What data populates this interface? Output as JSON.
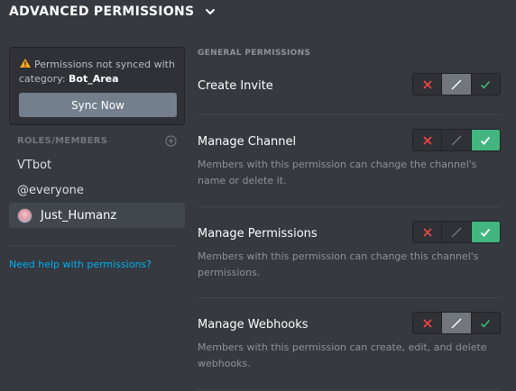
{
  "header": {
    "title": "ADVANCED PERMISSIONS",
    "icon": "chevron-down-icon"
  },
  "sync": {
    "message": "Permissions not synced with category:",
    "category": "Bot_Area",
    "button_label": "Sync Now",
    "icon": "warning-icon"
  },
  "roles": {
    "heading": "ROLES/MEMBERS",
    "add_icon": "add-circle-icon",
    "items": [
      {
        "label": "VTbot",
        "selected": false,
        "avatar": false
      },
      {
        "label": "@everyone",
        "selected": false,
        "avatar": false
      },
      {
        "label": "Just_Humanz",
        "selected": true,
        "avatar": true
      }
    ]
  },
  "help_link": "Need help with permissions?",
  "general": {
    "heading": "GENERAL PERMISSIONS",
    "permissions": [
      {
        "title": "Create Invite",
        "description": "",
        "state": "neutral"
      },
      {
        "title": "Manage Channel",
        "description": "Members with this permission can change the channel's name or delete it.",
        "state": "allow"
      },
      {
        "title": "Manage Permissions",
        "description": "Members with this permission can change this channel's permissions.",
        "state": "allow"
      },
      {
        "title": "Manage Webhooks",
        "description": "Members with this permission can create, edit, and delete webhooks.",
        "state": "neutral"
      }
    ]
  },
  "colors": {
    "background": "#36393f",
    "sidebar_box": "#2f3136",
    "allow": "#43b581",
    "deny": "#f04747",
    "neutral_on": "#72767d",
    "link": "#00b0f4"
  }
}
